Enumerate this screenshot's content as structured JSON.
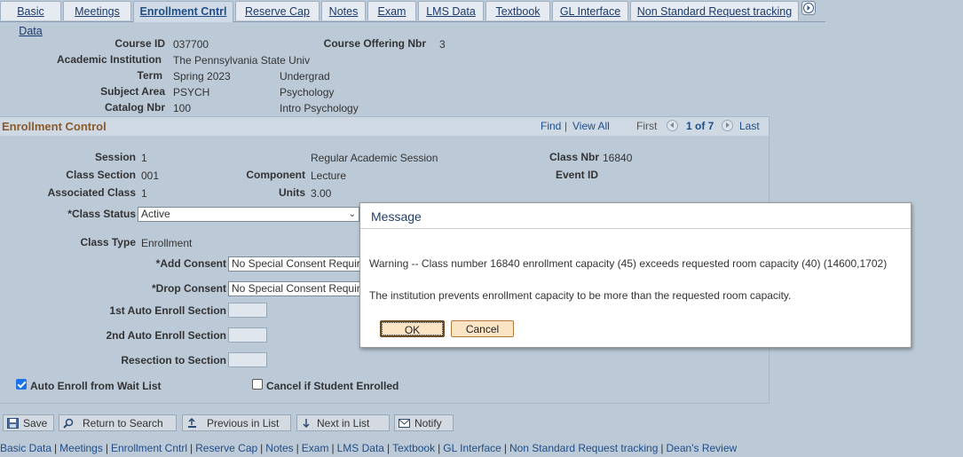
{
  "tabs": [
    {
      "label": "Basic Data",
      "active": false
    },
    {
      "label": "Meetings",
      "active": false
    },
    {
      "label": "Enrollment Cntrl",
      "active": true
    },
    {
      "label": "Reserve Cap",
      "active": false
    },
    {
      "label": "Notes",
      "active": false
    },
    {
      "label": "Exam",
      "active": false
    },
    {
      "label": "LMS Data",
      "active": false
    },
    {
      "label": "Textbook",
      "active": false
    },
    {
      "label": "GL Interface",
      "active": false
    },
    {
      "label": "Non Standard Request tracking",
      "active": false
    }
  ],
  "header": {
    "course_id_label": "Course ID",
    "course_id": "037700",
    "course_offering_label": "Course Offering Nbr",
    "course_offering": "3",
    "institution_label": "Academic Institution",
    "institution": "The Pennsylvania State Univ",
    "term_label": "Term",
    "term": "Spring 2023",
    "career": "Undergrad",
    "subject_label": "Subject Area",
    "subject": "PSYCH",
    "subject_desc": "Psychology",
    "catalog_label": "Catalog Nbr",
    "catalog": "100",
    "catalog_desc": "Intro Psychology"
  },
  "panel": {
    "title": "Enrollment Control",
    "find": "Find",
    "view_all": "View All",
    "first": "First",
    "count": "1 of 7",
    "last": "Last",
    "session_label": "Session",
    "session": "1",
    "session_desc": "Regular Academic Session",
    "class_nbr_label": "Class Nbr",
    "class_nbr": "16840",
    "class_section_label": "Class Section",
    "class_section": "001",
    "component_label": "Component",
    "component": "Lecture",
    "event_id_label": "Event ID",
    "assoc_class_label": "Associated Class",
    "assoc_class": "1",
    "units_label": "Units",
    "units": "3.00",
    "class_status_label": "*Class Status",
    "class_status": "Active",
    "class_type_label": "Class Type",
    "class_type": "Enrollment",
    "add_consent_label": "*Add Consent",
    "add_consent": "No Special Consent Required",
    "drop_consent_label": "*Drop Consent",
    "drop_consent": "No Special Consent Required",
    "auto_enroll_1_label": "1st Auto Enroll Section",
    "auto_enroll_2_label": "2nd Auto Enroll Section",
    "resection_label": "Resection to Section",
    "auto_enroll_waitlist_label": "Auto Enroll from Wait List",
    "auto_enroll_waitlist_checked": true,
    "cancel_if_enrolled_label": "Cancel if Student Enrolled",
    "cancel_if_enrolled_checked": false
  },
  "toolbar": {
    "save": "Save",
    "return": "Return to Search",
    "previous": "Previous in List",
    "next": "Next in List",
    "notify": "Notify"
  },
  "bottom_links": [
    "Basic Data",
    "Meetings",
    "Enrollment Cntrl",
    "Reserve Cap",
    "Notes",
    "Exam",
    "LMS Data",
    "Textbook",
    "GL Interface",
    "Non Standard Request tracking",
    "Dean's Review"
  ],
  "dialog": {
    "title": "Message",
    "line1": "Warning -- Class number 16840 enrollment capacity (45) exceeds requested room capacity (40) (14600,1702)",
    "line2": "The institution prevents enrollment capacity to be more than the requested room capacity.",
    "ok": "OK",
    "cancel": "Cancel"
  }
}
